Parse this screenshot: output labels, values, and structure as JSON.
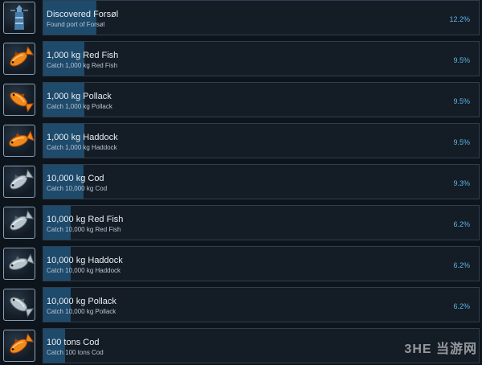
{
  "achievements": [
    {
      "name": "Discovered Forsøl",
      "description": "Found port of Forsøl",
      "percent": "12.2%",
      "progress": 0.122,
      "icon": "lighthouse-icon"
    },
    {
      "name": "1,000 kg Red Fish",
      "description": "Catch 1,000 kg Red Fish",
      "percent": "9.5%",
      "progress": 0.095,
      "icon": "red-fish-gold-icon"
    },
    {
      "name": "1,000 kg Pollack",
      "description": "Catch 1,000 kg Pollack",
      "percent": "9.5%",
      "progress": 0.095,
      "icon": "pollack-gold-icon"
    },
    {
      "name": "1,000 kg Haddock",
      "description": "Catch 1,000 kg Haddock",
      "percent": "9.5%",
      "progress": 0.095,
      "icon": "haddock-gold-icon"
    },
    {
      "name": "10,000 kg Cod",
      "description": "Catch 10,000 kg Cod",
      "percent": "9.3%",
      "progress": 0.093,
      "icon": "cod-silver-icon"
    },
    {
      "name": "10,000 kg Red Fish",
      "description": "Catch 10,000 kg Red Fish",
      "percent": "6.2%",
      "progress": 0.062,
      "icon": "red-fish-silver-icon"
    },
    {
      "name": "10,000 kg Haddock",
      "description": "Catch 10,000 kg Haddock",
      "percent": "6.2%",
      "progress": 0.062,
      "icon": "haddock-silver-icon"
    },
    {
      "name": "10,000 kg Pollack",
      "description": "Catch 10,000 kg Pollack",
      "percent": "6.2%",
      "progress": 0.062,
      "icon": "pollack-silver-icon"
    },
    {
      "name": "100 tons Cod",
      "description": "Catch 100 tons Cod",
      "percent": "",
      "progress": 0.05,
      "icon": "cod-gold-icon"
    }
  ],
  "watermark": "3HE 当游网",
  "colors": {
    "background": "#0e141b",
    "card": "#141c25",
    "progress_fill": "#1e4a6b",
    "percent_text": "#5fb4e8",
    "gold_fish": "#f08a1a",
    "silver_fish": "#b8c4cc"
  }
}
